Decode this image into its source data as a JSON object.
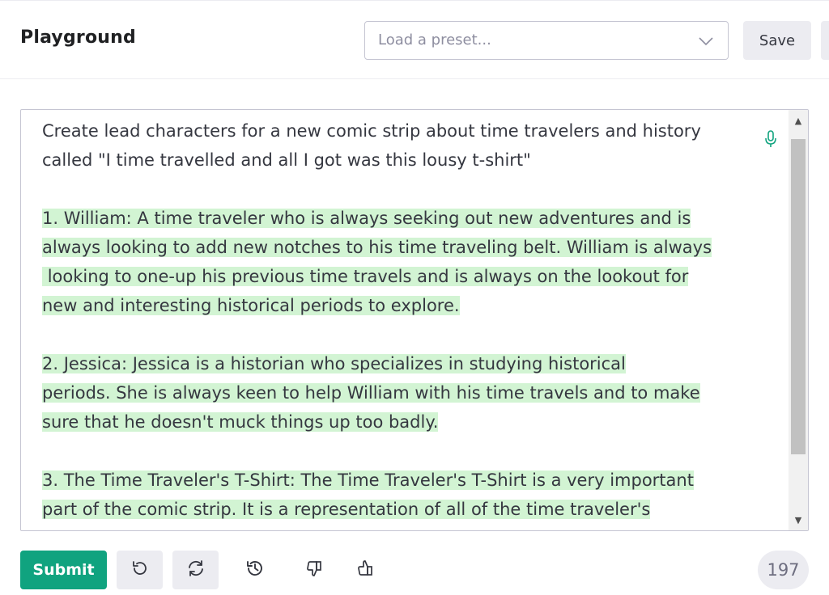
{
  "header": {
    "title": "Playground",
    "preset_placeholder": "Load a preset...",
    "save_label": "Save"
  },
  "editor": {
    "prompt_line1": "Create lead characters for a new comic strip about time travelers and history",
    "prompt_line2": "called \"I time travelled and all I got was this lousy t-shirt\"",
    "completion": [
      "1. William: A time traveler who is always seeking out new adventures and is",
      "always looking to add new notches to his time traveling belt. William is always",
      " looking to one-up his previous time travels and is always on the lookout for",
      "new and interesting historical periods to explore.",
      "2. Jessica: Jessica is a historian who specializes in studying historical",
      "periods. She is always keen to help William with his time travels and to make",
      "sure that he doesn't muck things up too badly.",
      "3. The Time Traveler's T-Shirt: The Time Traveler's T-Shirt is a very important",
      "part of the comic strip. It is a representation of all of the time traveler's"
    ],
    "scroll_up": "▲",
    "scroll_down": "▼"
  },
  "toolbar": {
    "submit_label": "Submit",
    "token_count": "197"
  },
  "icons": {
    "mic": "microphone-icon",
    "undo": "undo-icon",
    "regenerate": "regenerate-icon",
    "history": "history-icon",
    "thumbs_down": "thumbs-down-icon",
    "thumbs_up": "thumbs-up-icon",
    "chevron": "chevron-down-icon"
  },
  "colors": {
    "accent": "#10a37f",
    "highlight": "#d2f4d3",
    "button_bg": "#ececf1"
  }
}
